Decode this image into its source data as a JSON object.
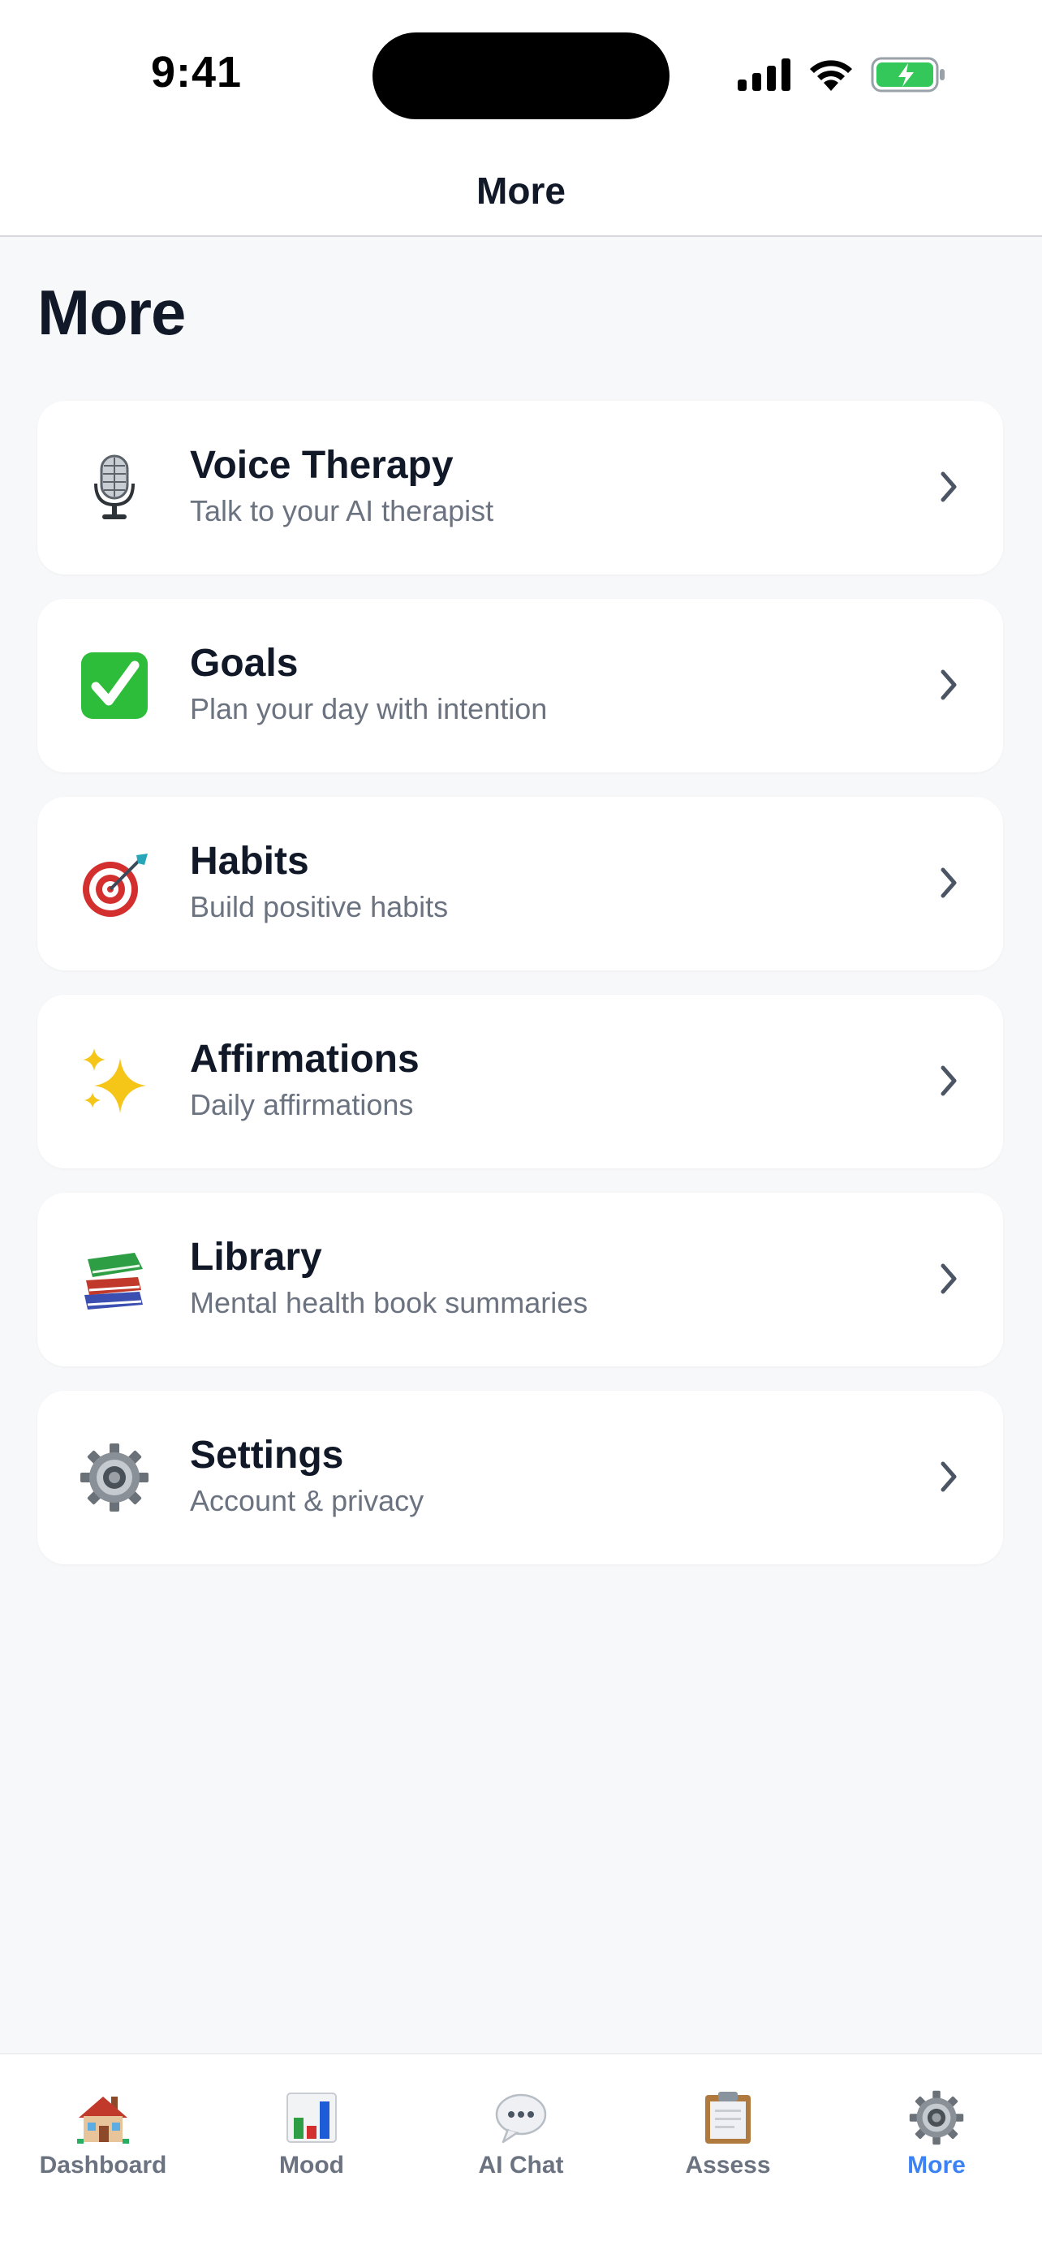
{
  "status_bar": {
    "time": "9:41",
    "icons": [
      "signal-icon",
      "wifi-icon",
      "battery-charging-icon"
    ]
  },
  "header": {
    "title": "More"
  },
  "page": {
    "title": "More"
  },
  "menu": {
    "items": [
      {
        "title": "Voice Therapy",
        "subtitle": "Talk to your AI therapist",
        "icon": "microphone-icon"
      },
      {
        "title": "Goals",
        "subtitle": "Plan your day with intention",
        "icon": "check-mark-icon"
      },
      {
        "title": "Habits",
        "subtitle": "Build positive habits",
        "icon": "target-icon"
      },
      {
        "title": "Affirmations",
        "subtitle": "Daily affirmations",
        "icon": "sparkles-icon"
      },
      {
        "title": "Library",
        "subtitle": "Mental health book summaries",
        "icon": "books-icon"
      },
      {
        "title": "Settings",
        "subtitle": "Account & privacy",
        "icon": "gear-icon"
      }
    ]
  },
  "tabs": {
    "items": [
      {
        "label": "Dashboard",
        "icon": "house-icon"
      },
      {
        "label": "Mood",
        "icon": "bar-chart-icon"
      },
      {
        "label": "AI Chat",
        "icon": "speech-bubble-icon"
      },
      {
        "label": "Assess",
        "icon": "clipboard-icon"
      },
      {
        "label": "More",
        "icon": "gear-icon"
      }
    ],
    "active": "More"
  },
  "colors": {
    "accent": "#3b82f6",
    "background": "#f7f8fa",
    "card": "#ffffff",
    "text_primary": "#111827",
    "text_secondary": "#6b7280",
    "battery_green": "#34c759"
  }
}
